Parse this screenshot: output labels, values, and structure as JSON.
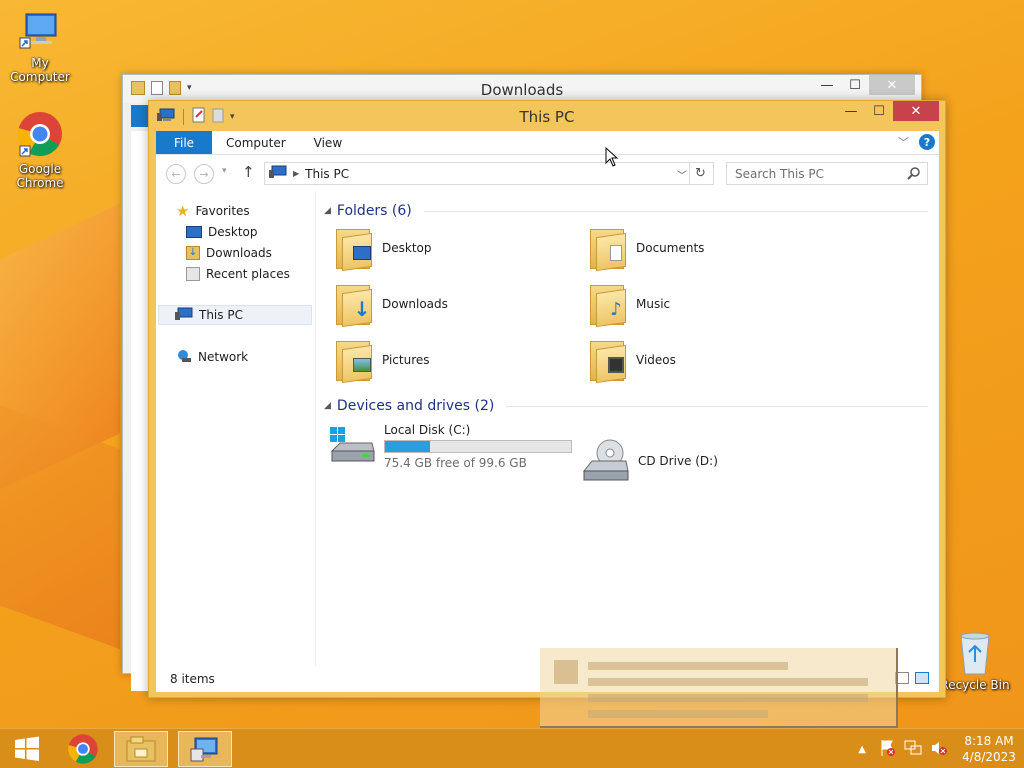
{
  "desktop": {
    "icons": [
      {
        "label": "My Computer"
      },
      {
        "label": "Google Chrome"
      },
      {
        "label": "Recycle Bin"
      }
    ]
  },
  "back_window": {
    "title": "Downloads",
    "controls": {
      "minimize": "—",
      "maximize": "☐",
      "close": "✕"
    }
  },
  "main_window": {
    "title": "This PC",
    "controls": {
      "minimize": "—",
      "maximize": "☐",
      "close": "✕"
    },
    "ribbon_tabs": [
      "File",
      "Computer",
      "View"
    ],
    "address": "This PC",
    "search_placeholder": "Search This PC",
    "nav_pane": {
      "favorites": "Favorites",
      "items": [
        "Desktop",
        "Downloads",
        "Recent places"
      ],
      "this_pc": "This PC",
      "network": "Network"
    },
    "folders_header": "Folders (6)",
    "folders": [
      {
        "name": "Desktop",
        "badge": "desktop-badge"
      },
      {
        "name": "Documents",
        "badge": "documents-badge"
      },
      {
        "name": "Downloads",
        "badge": "downloads-badge"
      },
      {
        "name": "Music",
        "badge": "music-badge"
      },
      {
        "name": "Pictures",
        "badge": "pictures-badge"
      },
      {
        "name": "Videos",
        "badge": "videos-badge"
      }
    ],
    "devices_header": "Devices and drives (2)",
    "drives": [
      {
        "name": "Local Disk (C:)",
        "free_text": "75.4 GB free of 99.6 GB",
        "used_fraction": 0.243
      },
      {
        "name": "CD Drive (D:)"
      }
    ],
    "status": "8 items"
  },
  "taskbar": {
    "time": "8:18 AM",
    "date": "4/8/2023"
  },
  "colors": {
    "accent": "#1979ca",
    "window_frame": "#f4c55a",
    "close_button": "#c7424a",
    "taskbar": "#d68c18"
  }
}
